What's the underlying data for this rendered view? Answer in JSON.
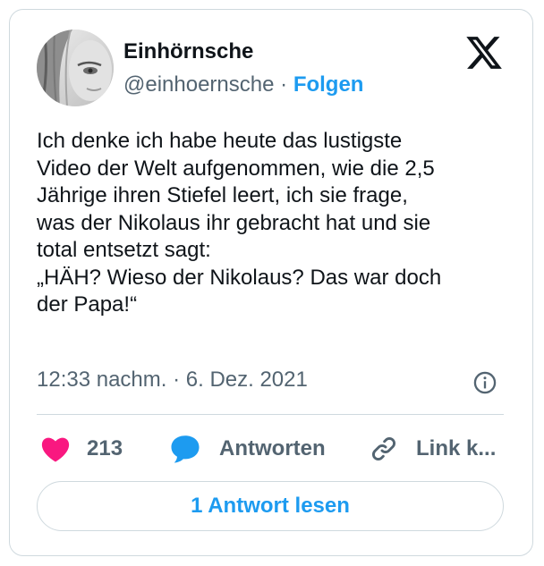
{
  "author": {
    "name": "Einhörnsche",
    "handle": "@einhoernsche",
    "separator": "·",
    "follow_label": "Folgen"
  },
  "brand_icon": "x-logo-icon",
  "tweet": {
    "lines": [
      "Ich denke ich habe heute das lustigste",
      "Video der Welt aufgenommen, wie die 2,5",
      "Jährige ihren Stiefel leert, ich sie frage,",
      "was der Nikolaus ihr gebracht hat und sie",
      "total entsetzt sagt:",
      "„HÄH? Wieso der Nikolaus? Das war doch",
      "der Papa!“"
    ],
    "timestamp": "12:33 nachm. · 6. Dez. 2021"
  },
  "actions": {
    "like_count": "213",
    "reply_label": "Antworten",
    "link_label": "Link k..."
  },
  "read_button_label": "1 Antwort lesen",
  "colors": {
    "accent": "#1d9bf0",
    "like": "#f91880",
    "text": "#0f1419",
    "muted": "#536471",
    "border": "#cfd9de"
  }
}
